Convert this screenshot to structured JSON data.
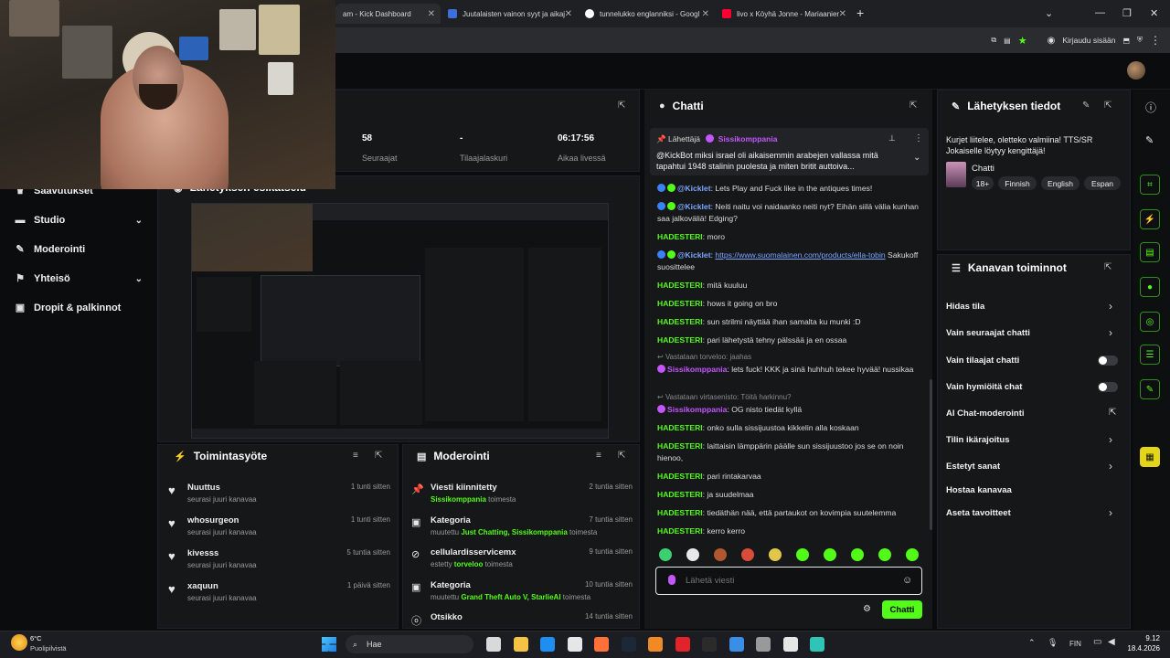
{
  "browser": {
    "tabs": [
      {
        "label": "am - Kick Dashboard",
        "active": true
      },
      {
        "label": "Juutalaisten vainon syyt ja aikaj"
      },
      {
        "label": "tunnelukko englanniksi - Googl"
      },
      {
        "label": "livo x Köyhä Jonne - Mariaanier"
      }
    ],
    "new_tab": "+",
    "signin_label": "Kirjaudu sisään"
  },
  "stream_stats": {
    "followers_value": "58",
    "followers_label": "Seuraajat",
    "subs_value": "-",
    "subs_label": "Tilaajalaskuri",
    "time_value": "06:17:56",
    "time_label": "Aikaa livessä"
  },
  "left_nav": {
    "achievements": "Saavutukset",
    "preview_title": "Lähetyksen esikatselu",
    "items": [
      {
        "label": "Studio",
        "chevron": true
      },
      {
        "label": "Moderointi",
        "chevron": false
      },
      {
        "label": "Yhteisö",
        "chevron": true
      },
      {
        "label": "Dropit & palkinnot",
        "chevron": false
      }
    ]
  },
  "activity_feed": {
    "title": "Toimintasyöte",
    "items": [
      {
        "name": "Nuuttus",
        "sub": "seurasi juuri kanavaa",
        "time": "1 tunti sitten"
      },
      {
        "name": "whosurgeon",
        "sub": "seurasi juuri kanavaa",
        "time": "1 tunti sitten"
      },
      {
        "name": "kivesss",
        "sub": "seurasi juuri kanavaa",
        "time": "5 tuntia sitten"
      },
      {
        "name": "xaquun",
        "sub": "seurasi juuri kanavaa",
        "time": "1 päivä sitten"
      }
    ]
  },
  "moderation": {
    "title": "Moderointi",
    "items": [
      {
        "icon": "pin-icon",
        "title": "Viesti kiinnitetty",
        "pre": "",
        "hl": "Sissikomppania",
        "post": " toimesta",
        "time": "2 tuntia sitten"
      },
      {
        "icon": "category-icon",
        "title": "Kategoria",
        "pre": "muutettu ",
        "hl": "Just Chatting, Sissikomppania",
        "post": " toimesta",
        "time": "7 tuntia sitten"
      },
      {
        "icon": "ban-icon",
        "title": "cellulardisservicemx",
        "pre": "estetty ",
        "hl": "torveloo",
        "post": " toimesta",
        "time": "9 tuntia sitten"
      },
      {
        "icon": "category-icon",
        "title": "Kategoria",
        "pre": "muutettu ",
        "hl": "Grand Theft Auto V, StarlieAI",
        "post": " toimesta",
        "time": "10 tuntia sitten"
      },
      {
        "icon": "title-icon",
        "title": "Otsikko",
        "pre": "",
        "hl": "",
        "post": "",
        "time": "14 tuntia sitten"
      }
    ]
  },
  "chat": {
    "title": "Chatti",
    "pinned": {
      "label": "Lähettäjä",
      "author": "Sissikomppania",
      "text": "@KickBot miksi israel oli aikaisemmin arabejen vallassa mitä tapahtui 1948 stalinin puolesta ja miten britit auttoiva..."
    },
    "messages": [
      {
        "user": "@Kicklet",
        "color": "b",
        "text": ": Lets Play and Fuck like in the antiques times!"
      },
      {
        "user": "@Kicklet",
        "color": "b",
        "text": ": Neiti naitu voi naidaanko neiti nyt? Eihän siilä välia kunhan saa jalkoväliä! Edging?"
      },
      {
        "user": "HADESTERI",
        "color": "g",
        "text": ": moro"
      },
      {
        "user": "@Kicklet",
        "color": "b",
        "text": ": ",
        "link": "https://www.suomalainen.com/products/ella-tobin",
        "after": " Sakukoff suosittelee"
      },
      {
        "user": "HADESTERI",
        "color": "g",
        "text": ": mitä kuuluu"
      },
      {
        "user": "HADESTERI",
        "color": "g",
        "text": ": hows it going on bro"
      },
      {
        "user": "HADESTERI",
        "color": "g",
        "text": ": sun strilmi näyttää ihan samalta ku munki :D"
      },
      {
        "user": "HADESTERI",
        "color": "g",
        "text": ": pari lähetystä tehny pälssää ja en ossaa"
      },
      {
        "reply": "Vastataan torveloo: jaahas",
        "user": "Sissikomppania",
        "color": "p",
        "text": ": lets fuck! KKK ja sinä huhhuh tekee hyvää! nussikaa"
      },
      {
        "reply": "Vastataan virtasenisto: Töitä harkinnu?",
        "user": "Sissikomppania",
        "color": "p",
        "text": ": OG nisto tiedät kyllä"
      },
      {
        "user": "HADESTERI",
        "color": "g",
        "text": ": onko sulla sissijuustoa kikkelin alla koskaan"
      },
      {
        "user": "HADESTERI",
        "color": "g",
        "text": ": laittaisin lämppärin päälle sun sissijuustoo jos se on noin hienoo,"
      },
      {
        "user": "HADESTERI",
        "color": "g",
        "text": ": pari rintakarvaa"
      },
      {
        "user": "HADESTERI",
        "color": "g",
        "text": ": ja suudelmaa"
      },
      {
        "user": "HADESTERI",
        "color": "g",
        "text": ": tiedäthän nää, että partaukot on kovimpia suutelemma"
      },
      {
        "user": "HADESTERI",
        "color": "g",
        "text": ": kerro kerro"
      }
    ],
    "input_placeholder": "Lähetä viesti",
    "send_label": "Chatti"
  },
  "stream_info": {
    "title": "Lähetyksen tiedot",
    "stream_title": "Kurjet liitelee, oletteko valmiina! TTS/SR Jokaiselle löytyy kengittäjä!",
    "category": "Chatti",
    "tags": [
      "18+",
      "Finnish",
      "English",
      "Espan"
    ]
  },
  "channel_actions": {
    "title": "Kanavan toiminnot",
    "items": [
      {
        "label": "Hidas tila",
        "kind": "chevron"
      },
      {
        "label": "Vain seuraajat chatti",
        "kind": "chevron"
      },
      {
        "label": "Vain tilaajat chatti",
        "kind": "toggle"
      },
      {
        "label": "Vain hymiöitä chat",
        "kind": "toggle"
      },
      {
        "label": "AI Chat-moderointi",
        "kind": "external"
      },
      {
        "label": "Tilin ikärajoitus",
        "kind": "chevron"
      },
      {
        "label": "Estetyt sanat",
        "kind": "chevron"
      },
      {
        "label": "Hostaa kanavaa",
        "kind": "none"
      },
      {
        "label": "Aseta tavoitteet",
        "kind": "chevron"
      }
    ]
  },
  "taskbar": {
    "weather_temp": "6°C",
    "weather_desc": "Puolipilvistä",
    "search": "Hae",
    "lang": "FIN",
    "time": "9.12",
    "date": "18.4.2026"
  },
  "colors": {
    "accent": "#53fc18",
    "purple": "#c356ff",
    "panel": "#161719",
    "bg": "#0b0c0d"
  }
}
